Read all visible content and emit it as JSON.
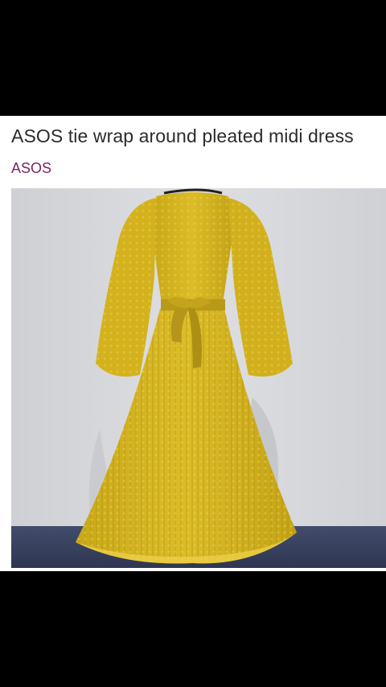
{
  "post": {
    "title": "ASOS tie wrap around pleated midi dress",
    "brand": "ASOS"
  },
  "photo": {
    "subject": "dress-photo",
    "colors": {
      "wall": "#d8d9dc",
      "floor": "#3a4464",
      "dress": "#d7b51f",
      "dress_shadow": "#a88d12",
      "dress_highlight": "#e6c93a"
    }
  }
}
